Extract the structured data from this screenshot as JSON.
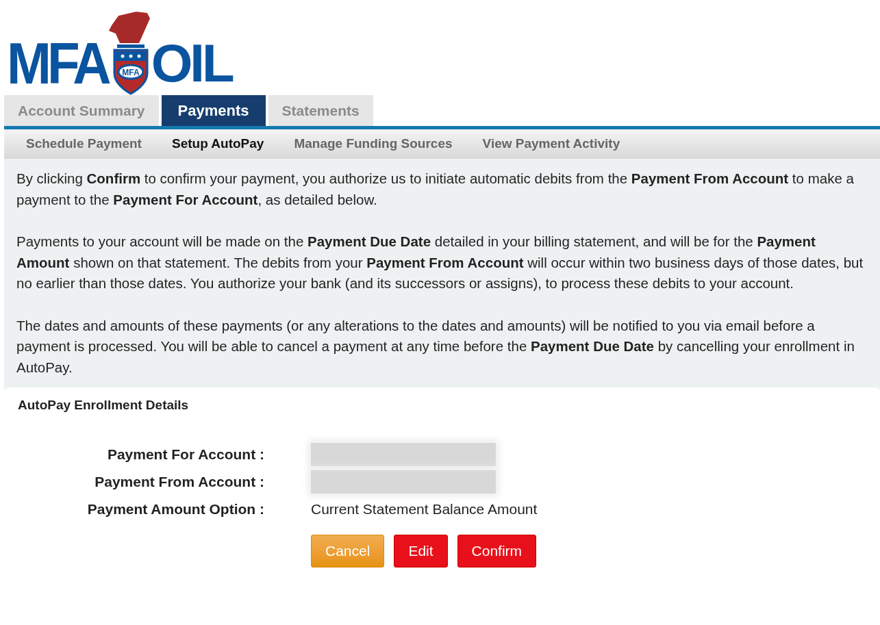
{
  "logo": {
    "left": "MFA",
    "right": "OIL",
    "badge": "MFA"
  },
  "tabs": [
    {
      "label": "Account Summary",
      "selected": false
    },
    {
      "label": "Payments",
      "selected": true
    },
    {
      "label": "Statements",
      "selected": false
    }
  ],
  "subnav": [
    {
      "label": "Schedule Payment",
      "selected": false
    },
    {
      "label": "Setup AutoPay",
      "selected": true
    },
    {
      "label": "Manage Funding Sources",
      "selected": false
    },
    {
      "label": "View Payment Activity",
      "selected": false
    }
  ],
  "paragraphs": [
    "By clicking **Confirm** to confirm your payment, you authorize us to initiate automatic debits from the **Payment From Account** to make a payment to the **Payment For Account**, as detailed below.",
    "Payments to your account will be made on the **Payment Due Date** detailed in your billing statement, and will be for the **Payment Amount** shown on that statement. The debits from your **Payment From Account** will occur within two business days of those dates, but no earlier than those dates. You authorize your bank (and its successors or assigns), to process these debits to your account.",
    "The dates and amounts of these payments (or any alterations to the dates and amounts) will be notified to you via email before a payment is processed. You will be able to cancel a payment at any time before the **Payment Due Date** by cancelling your enrollment in AutoPay."
  ],
  "details": {
    "title": "AutoPay Enrollment Details",
    "fields": [
      {
        "label": "Payment For Account :",
        "redacted": true
      },
      {
        "label": "Payment From Account :",
        "redacted": true
      },
      {
        "label": "Payment Amount Option :",
        "value": "Current Statement Balance Amount"
      }
    ]
  },
  "buttons": [
    {
      "label": "Cancel",
      "kind": "warning"
    },
    {
      "label": "Edit",
      "kind": "danger"
    },
    {
      "label": "Confirm",
      "kind": "danger"
    }
  ]
}
